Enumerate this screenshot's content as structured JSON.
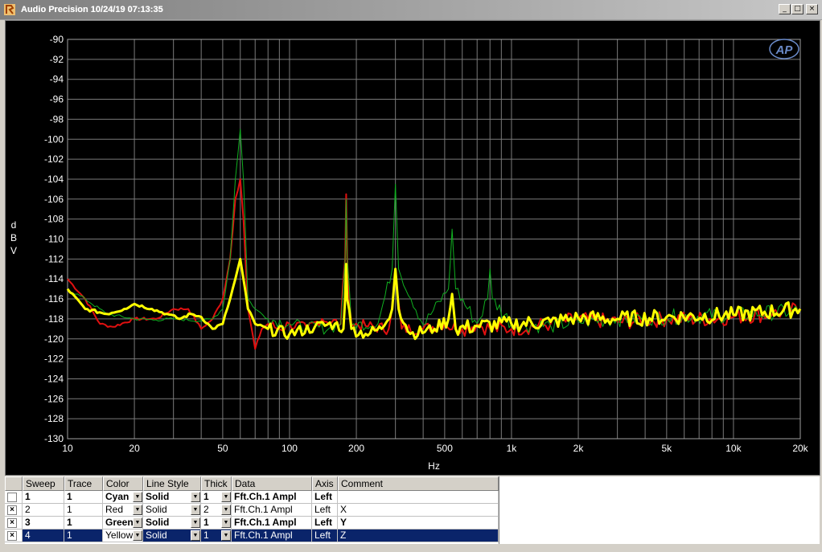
{
  "window": {
    "title": "Audio Precision  10/24/19 07:13:35",
    "minimize_glyph": "_",
    "maximize_glyph": "□",
    "close_glyph": "×"
  },
  "logo": {
    "text": "AP"
  },
  "colors": {
    "plot_bg": "#000000",
    "grid": "#7a7a7a",
    "axis_text": "#ffffff",
    "trace_red": "#e01010",
    "trace_green": "#10b020",
    "trace_yellow": "#ffff00",
    "selection": "#0a246a"
  },
  "chart_data": {
    "type": "line",
    "xlabel": "Hz",
    "ylabel": "dBV",
    "xscale": "log",
    "xlim": [
      10,
      20000
    ],
    "ylim": [
      -130,
      -90
    ],
    "x_ticks": [
      10,
      20,
      50,
      100,
      200,
      500,
      1000,
      2000,
      5000,
      10000,
      20000
    ],
    "x_tick_labels": [
      "10",
      "20",
      "50",
      "100",
      "200",
      "500",
      "1k",
      "2k",
      "5k",
      "10k",
      "20k"
    ],
    "y_ticks": [
      -90,
      -92,
      -94,
      -96,
      -98,
      -100,
      -102,
      -104,
      -106,
      -108,
      -110,
      -112,
      -114,
      -116,
      -118,
      -120,
      -122,
      -124,
      -126,
      -128,
      -130
    ],
    "grid": true,
    "series": [
      {
        "color": "red",
        "x": [
          10,
          12,
          14,
          16,
          20,
          25,
          30,
          35,
          40,
          45,
          50,
          54,
          57,
          60,
          62,
          65,
          70,
          75,
          80,
          90,
          100,
          120,
          140,
          170,
          178,
          180,
          182,
          190,
          220,
          280,
          300,
          320,
          400,
          500,
          600,
          700,
          800,
          1000,
          1500,
          2000,
          3000,
          5000,
          8000,
          10000,
          15000,
          20000
        ],
        "y": [
          -114,
          -116,
          -118.5,
          -118.8,
          -118,
          -118,
          -117,
          -117,
          -119,
          -118,
          -116,
          -112,
          -106,
          -104,
          -108,
          -117,
          -121,
          -119,
          -118.5,
          -119,
          -118.5,
          -119,
          -118,
          -118.5,
          -112,
          -105.5,
          -112,
          -118.5,
          -118.7,
          -119,
          -114,
          -119,
          -119,
          -118.5,
          -119,
          -118.5,
          -119,
          -119,
          -118.5,
          -118,
          -118.3,
          -118,
          -118,
          -117.8,
          -117.5,
          -117
        ]
      },
      {
        "color": "green",
        "x": [
          10,
          12,
          15,
          20,
          25,
          30,
          40,
          45,
          50,
          54,
          57,
          60,
          62,
          65,
          70,
          80,
          100,
          120,
          150,
          170,
          178,
          180,
          182,
          190,
          250,
          290,
          300,
          310,
          400,
          520,
          540,
          560,
          700,
          780,
          800,
          820,
          1000,
          1500,
          2000,
          3000,
          5000,
          10000,
          20000
        ],
        "y": [
          -115,
          -116,
          -117.5,
          -118,
          -118.1,
          -118,
          -118.2,
          -118,
          -117,
          -112,
          -104,
          -99,
          -104,
          -116,
          -117,
          -118,
          -118.5,
          -118.8,
          -119,
          -118.5,
          -112,
          -106,
          -112,
          -118.6,
          -118.5,
          -113,
          -104.5,
          -113,
          -118.6,
          -115,
          -109,
          -115,
          -118.5,
          -116,
          -113,
          -116,
          -118.5,
          -118.7,
          -118.3,
          -118,
          -117.8,
          -117.6,
          -117.2
        ]
      },
      {
        "color": "yellow",
        "x": [
          10,
          12,
          15,
          18,
          20,
          24,
          28,
          32,
          36,
          40,
          45,
          50,
          54,
          57,
          60,
          62,
          65,
          70,
          80,
          100,
          130,
          160,
          175,
          178,
          180,
          182,
          190,
          220,
          260,
          290,
          300,
          310,
          350,
          450,
          520,
          540,
          560,
          700,
          1000,
          1500,
          2000,
          3000,
          5000,
          10000,
          20000
        ],
        "y": [
          -115,
          -117,
          -117.5,
          -117,
          -116.5,
          -117,
          -117.5,
          -118,
          -117.5,
          -117.8,
          -119,
          -118.5,
          -116,
          -114,
          -112,
          -114,
          -117,
          -118.5,
          -119,
          -119.5,
          -118.8,
          -118.5,
          -119,
          -116,
          -112.5,
          -116,
          -119,
          -119.5,
          -119,
          -117,
          -113,
          -117,
          -119.5,
          -119,
          -118,
          -115.5,
          -119,
          -118.7,
          -118.5,
          -118.3,
          -117.9,
          -118,
          -117.8,
          -117.6,
          -117
        ]
      }
    ]
  },
  "table": {
    "headers": [
      "Sweep",
      "Trace",
      "Color",
      "Line Style",
      "Thick",
      "Data",
      "Axis",
      "Comment"
    ],
    "rows": [
      {
        "checked": "",
        "sweep": "1",
        "trace": "1",
        "color": "Cyan",
        "style": "Solid",
        "thick": "1",
        "data": "Fft.Ch.1 Ampl",
        "axis": "Left",
        "comment": ""
      },
      {
        "checked": "×",
        "sweep": "2",
        "trace": "1",
        "color": "Red",
        "style": "Solid",
        "thick": "2",
        "data": "Fft.Ch.1 Ampl",
        "axis": "Left",
        "comment": "X"
      },
      {
        "checked": "×",
        "sweep": "3",
        "trace": "1",
        "color": "Green",
        "style": "Solid",
        "thick": "1",
        "data": "Fft.Ch.1 Ampl",
        "axis": "Left",
        "comment": "Y"
      },
      {
        "checked": "×",
        "sweep": "4",
        "trace": "1",
        "color": "Yellow",
        "style": "Solid",
        "thick": "1",
        "data": "Fft.Ch.1 Ampl",
        "axis": "Left",
        "comment": "Z"
      }
    ]
  }
}
